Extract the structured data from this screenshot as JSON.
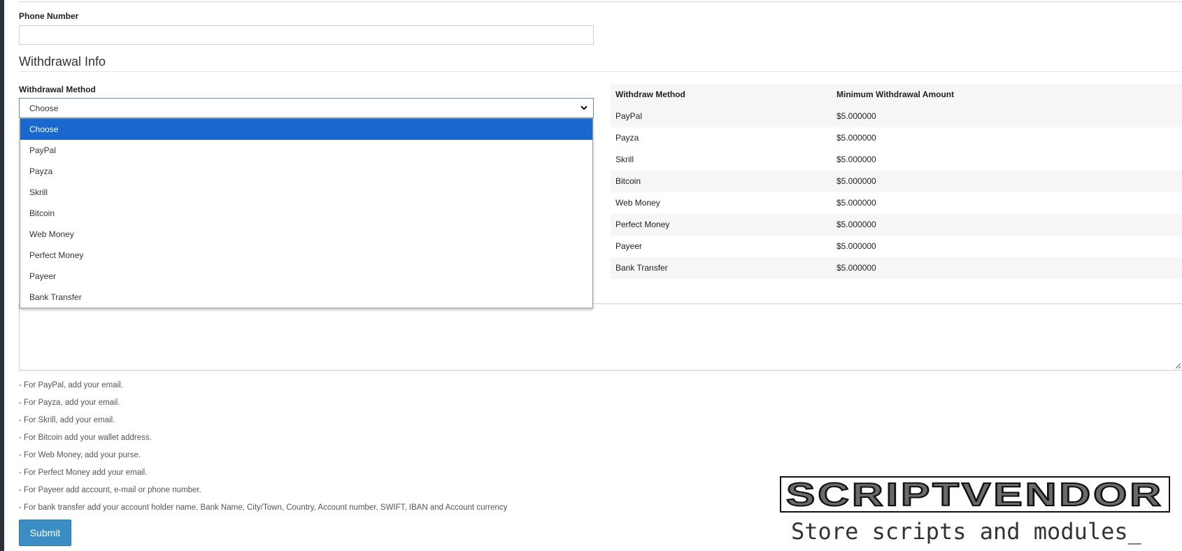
{
  "form": {
    "phone_label": "Phone Number",
    "phone_value": "",
    "section_title": "Withdrawal Info",
    "method_label": "Withdrawal Method",
    "method_selected": "Choose",
    "method_options": [
      "Choose",
      "PayPal",
      "Payza",
      "Skrill",
      "Bitcoin",
      "Web Money",
      "Perfect Money",
      "Payeer",
      "Bank Transfer"
    ],
    "details_value": "",
    "submit_label": "Submit"
  },
  "methods_table": {
    "headers": [
      "Withdraw Method",
      "Minimum Withdrawal Amount"
    ],
    "rows": [
      [
        "PayPal",
        "$5.000000"
      ],
      [
        "Payza",
        "$5.000000"
      ],
      [
        "Skrill",
        "$5.000000"
      ],
      [
        "Bitcoin",
        "$5.000000"
      ],
      [
        "Web Money",
        "$5.000000"
      ],
      [
        "Perfect Money",
        "$5.000000"
      ],
      [
        "Payeer",
        "$5.000000"
      ],
      [
        "Bank Transfer",
        "$5.000000"
      ]
    ]
  },
  "notes": [
    "- For PayPal, add your email.",
    "- For Payza, add your email.",
    "- For Skrill, add your email.",
    "- For Bitcoin add your wallet address.",
    "- For Web Money, add your purse.",
    "- For Perfect Money add your email.",
    "- For Payeer add account, e-mail or phone number.",
    "- For bank transfer add your account holder name, Bank Name, City/Town, Country, Account number, SWIFT, IBAN and Account currency"
  ],
  "watermark": {
    "brand": "SCRIPTVENDOR",
    "tagline": "Store scripts and modules_"
  },
  "colors": {
    "selected_option": "#1a67d0",
    "submit_button": "#3b8ec4"
  }
}
